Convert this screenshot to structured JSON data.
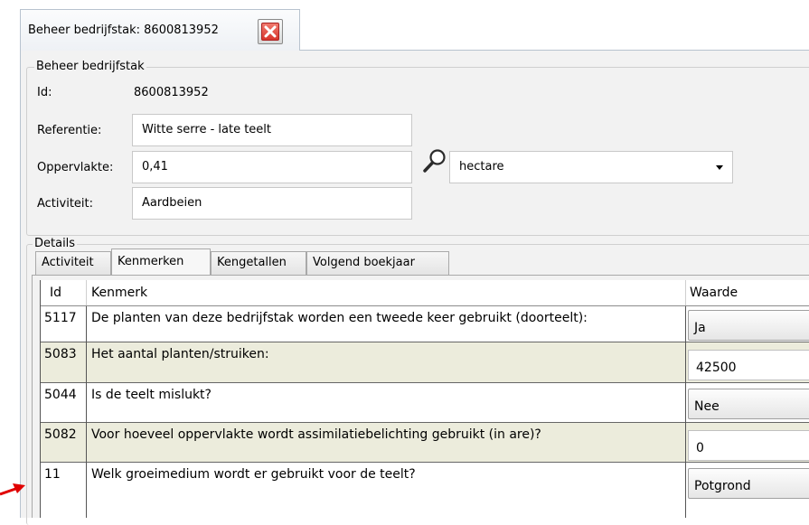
{
  "doc_tab": {
    "title": "Beheer bedrijfstak: 8600813952"
  },
  "beheer": {
    "legend": "Beheer bedrijfstak",
    "id_label": "Id:",
    "id_value": "8600813952",
    "referentie_label": "Referentie:",
    "referentie_value": "Witte serre - late teelt",
    "oppervlakte_label": "Oppervlakte:",
    "oppervlakte_value": "0,41",
    "unit_value": "hectare",
    "activiteit_label": "Activiteit:",
    "activiteit_value": "Aardbeien"
  },
  "details": {
    "legend": "Details",
    "tabs": [
      "Activiteit",
      "Kenmerken",
      "Kengetallen",
      "Volgend boekjaar"
    ],
    "active_tab": "Kenmerken"
  },
  "grid": {
    "columns": [
      "Id",
      "Kenmerk",
      "Waarde"
    ],
    "rows": [
      {
        "id": "5117",
        "kenmerk": "De planten van deze bedrijfstak worden een tweede keer gebruikt (doorteelt):",
        "waarde": "Ja",
        "editor": "combo"
      },
      {
        "id": "5083",
        "kenmerk": "Het aantal planten/struiken:",
        "waarde": "42500",
        "editor": "text"
      },
      {
        "id": "5044",
        "kenmerk": "Is de teelt mislukt?",
        "waarde": "Nee",
        "editor": "combo"
      },
      {
        "id": "5082",
        "kenmerk": "Voor hoeveel oppervlakte wordt assimilatiebelichting gebruikt (in are)?",
        "waarde": "0",
        "editor": "text"
      },
      {
        "id": "11",
        "kenmerk": "Welk groeimedium wordt er gebruikt voor de teelt?",
        "waarde": "Potgrond",
        "editor": "combo"
      }
    ]
  },
  "colors": {
    "alt_row": "#ececdc",
    "close_red": "#d8342b",
    "annotation_arrow": "#e00000"
  }
}
